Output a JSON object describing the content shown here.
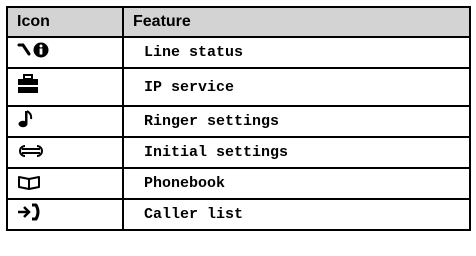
{
  "table": {
    "headers": {
      "icon": "Icon",
      "feature": "Feature"
    },
    "rows": [
      {
        "icon": "line-status-icon",
        "feature": "Line status"
      },
      {
        "icon": "ip-service-icon",
        "feature": "IP service"
      },
      {
        "icon": "ringer-note-icon",
        "feature": "Ringer settings"
      },
      {
        "icon": "wrench-icon",
        "feature": "Initial settings"
      },
      {
        "icon": "phonebook-icon",
        "feature": "Phonebook"
      },
      {
        "icon": "caller-list-icon",
        "feature": "Caller list"
      }
    ]
  }
}
